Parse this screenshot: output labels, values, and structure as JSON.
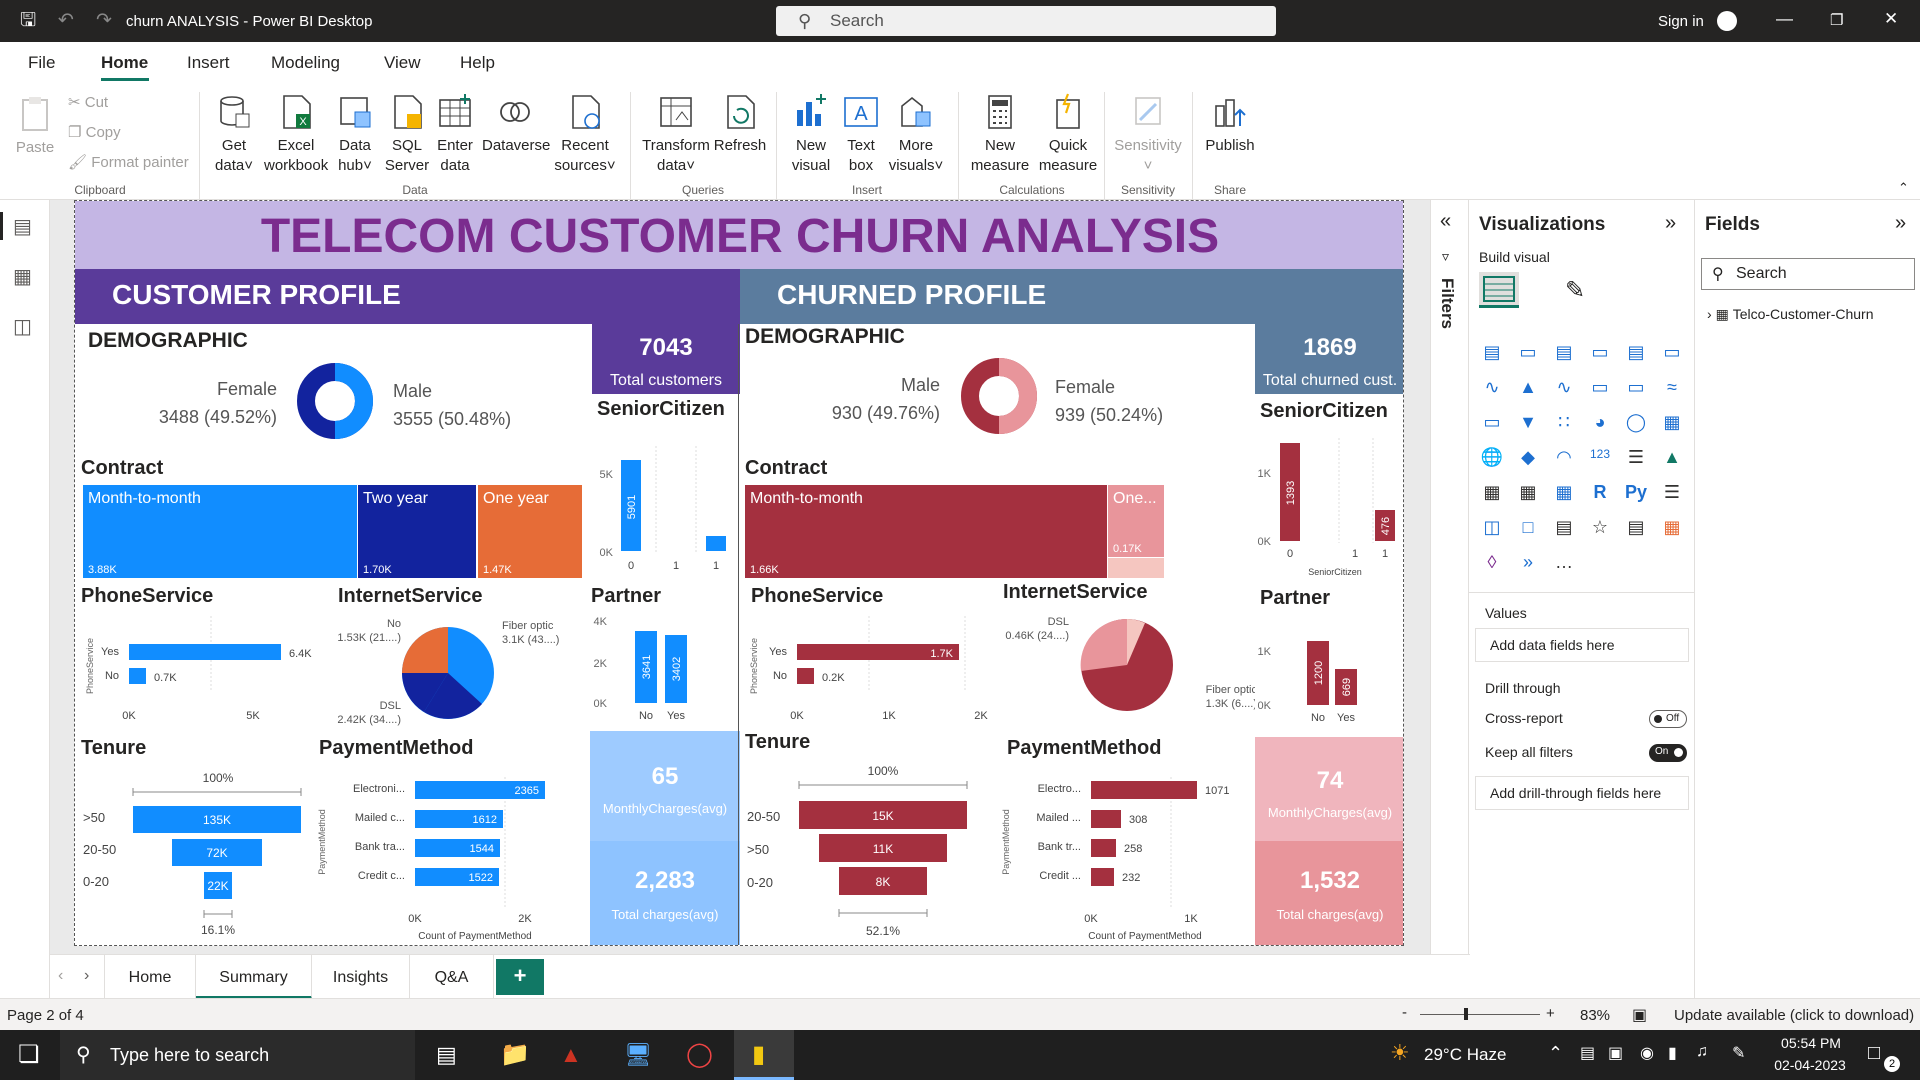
{
  "window": {
    "title": "churn ANALYSIS - Power BI Desktop",
    "search_placeholder": "Search",
    "sign_in": "Sign in"
  },
  "menu": {
    "items": [
      "File",
      "Home",
      "Insert",
      "Modeling",
      "View",
      "Help"
    ]
  },
  "ribbon": {
    "paste": "Paste",
    "cut": "Cut",
    "copy": "Copy",
    "format_painter": "Format painter",
    "clipboard_group": "Clipboard",
    "get_data": [
      "Get",
      "data"
    ],
    "excel": [
      "Excel",
      "workbook"
    ],
    "data_hub": [
      "Data",
      "hub"
    ],
    "sql": [
      "SQL",
      "Server"
    ],
    "enter": [
      "Enter",
      "data"
    ],
    "dataverse": "Dataverse",
    "recent": [
      "Recent",
      "sources"
    ],
    "data_group": "Data",
    "transform": [
      "Transform",
      "data"
    ],
    "refresh": "Refresh",
    "queries_group": "Queries",
    "new_visual": [
      "New",
      "visual"
    ],
    "text_box": [
      "Text",
      "box"
    ],
    "more_visuals": [
      "More",
      "visuals"
    ],
    "insert_group": "Insert",
    "new_measure": [
      "New",
      "measure"
    ],
    "quick_measure": [
      "Quick",
      "measure"
    ],
    "calc_group": "Calculations",
    "sensitivity": "Sensitivity",
    "sens_group": "Sensitivity",
    "publish": "Publish",
    "share_group": "Share"
  },
  "report": {
    "title": "TELECOM CUSTOMER CHURN ANALYSIS",
    "customer": {
      "header": "CUSTOMER PROFILE",
      "demographic": "DEMOGRAPHIC",
      "female_label": "Female",
      "female_value": "3488 (49.52%)",
      "male_label": "Male",
      "male_value": "3555 (50.48%)",
      "kpi_total_value": "7043",
      "kpi_total_label": "Total customers",
      "senior_title": "SeniorCitizen",
      "senior_bar0": "5901",
      "senior_y": [
        "5K",
        "0K"
      ],
      "senior_x": [
        "0",
        "1",
        "1"
      ],
      "contract_title": "Contract",
      "contract": [
        {
          "label": "Month-to-month",
          "value": "3.88K"
        },
        {
          "label": "Two year",
          "value": "1.70K"
        },
        {
          "label": "One year",
          "value": "1.47K"
        }
      ],
      "phone_title": "PhoneService",
      "phone_axis": "PhoneService",
      "phone_rows": [
        {
          "label": "Yes",
          "value": "6.4K"
        },
        {
          "label": "No",
          "value": "0.7K"
        }
      ],
      "phone_x": [
        "0K",
        "5K"
      ],
      "internet_title": "InternetService",
      "internet_labels": [
        {
          "name": "No",
          "value": "1.53K (21....)"
        },
        {
          "name": "Fiber optic",
          "value": "3.1K (43....)"
        },
        {
          "name": "DSL",
          "value": "2.42K (34....)"
        }
      ],
      "partner_title": "Partner",
      "partner_y": [
        "4K",
        "2K",
        "0K"
      ],
      "partner_bars": [
        "3641",
        "3402"
      ],
      "partner_x": [
        "No",
        "Yes"
      ],
      "tenure_title": "Tenure",
      "tenure_top": "100%",
      "tenure_bottom": "16.1%",
      "tenure_rows": [
        {
          "label": ">50",
          "value": "135K"
        },
        {
          "label": "20-50",
          "value": "72K"
        },
        {
          "label": "0-20",
          "value": "22K"
        }
      ],
      "payment_title": "PaymentMethod",
      "payment_axis": "PaymentMethod",
      "payment_rows": [
        {
          "label": "Electroni...",
          "value": "2365"
        },
        {
          "label": "Mailed c...",
          "value": "1612"
        },
        {
          "label": "Bank tra...",
          "value": "1544"
        },
        {
          "label": "Credit c...",
          "value": "1522"
        }
      ],
      "payment_x": [
        "0K",
        "2K"
      ],
      "payment_xlabel": "Count of PaymentMethod",
      "kpi_monthly_value": "65",
      "kpi_monthly_label": "MonthlyCharges(avg)",
      "kpi_total_charges_value": "2,283",
      "kpi_total_charges_label": "Total charges(avg)"
    },
    "churned": {
      "header": "CHURNED PROFILE",
      "demographic": "DEMOGRAPHIC",
      "male_label": "Male",
      "male_value": "930 (49.76%)",
      "female_label": "Female",
      "female_value": "939 (50.24%)",
      "kpi_total_value": "1869",
      "kpi_total_label": "Total churned cust.",
      "senior_title": "SeniorCitizen",
      "senior_bars": [
        "1393",
        "476"
      ],
      "senior_y": [
        "1K",
        "0K"
      ],
      "senior_x": [
        "0",
        "1",
        "1"
      ],
      "senior_xlabel": "SeniorCitizen",
      "contract_title": "Contract",
      "contract": [
        {
          "label": "Month-to-month",
          "value": "1.66K"
        },
        {
          "label": "One...",
          "value": "0.17K"
        }
      ],
      "phone_title": "PhoneService",
      "phone_axis": "PhoneService",
      "phone_rows": [
        {
          "label": "Yes",
          "value": "1.7K"
        },
        {
          "label": "No",
          "value": "0.2K"
        }
      ],
      "phone_x": [
        "0K",
        "1K",
        "2K"
      ],
      "internet_title": "InternetService",
      "internet_labels": [
        {
          "name": "DSL",
          "value": "0.46K (24....)"
        },
        {
          "name": "Fiber optic",
          "value": "1.3K (6....)"
        }
      ],
      "partner_title": "Partner",
      "partner_y": [
        "1K",
        "0K"
      ],
      "partner_bars": [
        "1200",
        "669"
      ],
      "partner_x": [
        "No",
        "Yes"
      ],
      "tenure_title": "Tenure",
      "tenure_top": "100%",
      "tenure_bottom": "52.1%",
      "tenure_rows": [
        {
          "label": "20-50",
          "value": "15K"
        },
        {
          "label": ">50",
          "value": "11K"
        },
        {
          "label": "0-20",
          "value": "8K"
        }
      ],
      "payment_title": "PaymentMethod",
      "payment_axis": "PaymentMethod",
      "payment_rows": [
        {
          "label": "Electro...",
          "value": "1071"
        },
        {
          "label": "Mailed ...",
          "value": "308"
        },
        {
          "label": "Bank tr...",
          "value": "258"
        },
        {
          "label": "Credit ...",
          "value": "232"
        }
      ],
      "payment_x": [
        "0K",
        "1K"
      ],
      "payment_xlabel": "Count of PaymentMethod",
      "kpi_monthly_value": "74",
      "kpi_monthly_label": "MonthlyCharges(avg)",
      "kpi_total_charges_value": "1,532",
      "kpi_total_charges_label": "Total charges(avg)"
    }
  },
  "filters": {
    "label": "Filters"
  },
  "visualizations": {
    "title": "Visualizations",
    "build_visual": "Build visual",
    "values": "Values",
    "add_data": "Add data fields here",
    "drill_through": "Drill through",
    "cross_report": "Cross-report",
    "cross_report_state": "Off",
    "keep_filters": "Keep all filters",
    "keep_filters_state": "On",
    "add_drill": "Add drill-through fields here"
  },
  "fields": {
    "title": "Fields",
    "search_placeholder": "Search",
    "table": "Telco-Customer-Churn"
  },
  "tabs": {
    "items": [
      "Home",
      "Summary",
      "Insights",
      "Q&A"
    ],
    "add": "+"
  },
  "status": {
    "page": "Page 2 of 4",
    "zoom": "83%",
    "update": "Update available (click to download)"
  },
  "taskbar": {
    "search": "Type here to search",
    "weather": "29°C  Haze",
    "time": "05:54 PM",
    "date": "02-04-2023",
    "notif": "2"
  },
  "colors": {
    "blue": "#118dff",
    "navy": "#12239e",
    "orange": "#e66c37",
    "purple": "#5a3b9a",
    "steel": "#5b7c9e",
    "maroon": "#a4303f",
    "pink": "#e8959b",
    "light_pink": "#f2c4c4",
    "kpi_blue_top": "#9ecbff",
    "kpi_blue_bottom": "#8ec3ff",
    "kpi_pink_top": "#f0b5bd",
    "kpi_pink_bottom": "#e8959b",
    "banner": "#c4b6e4",
    "banner_text": "#7b2c8e"
  }
}
